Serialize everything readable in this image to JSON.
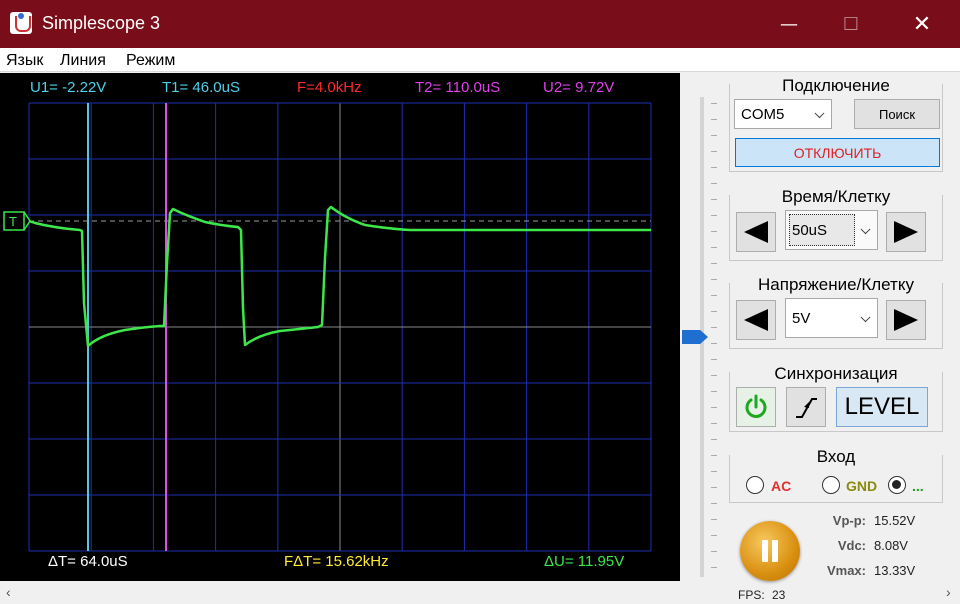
{
  "window": {
    "title": "Simplescope 3",
    "min_glyph": "—",
    "max_glyph": "☐",
    "close_glyph": "✕"
  },
  "menu": [
    "Язык",
    "Линия",
    "Режим"
  ],
  "scope": {
    "top_readouts": {
      "u1": "U1= -2.22V",
      "t1": "T1= 46.0uS",
      "f": "F=4.0kHz",
      "t2": "T2= 110.0uS",
      "u2": "U2= 9.72V"
    },
    "bottom_readouts": {
      "dt": "ΔT= 64.0uS",
      "fdt": "FΔT= 15.62kHz",
      "du": "ΔU= 11.95V"
    },
    "trigger_marker": "T",
    "colors": {
      "grid": "#1c2fb5",
      "trace": "#3de64a",
      "cursor1": "#56c8dc",
      "cursor2": "#e04fe8",
      "u1": "#4fd0e8",
      "t1": "#4fd0e8",
      "f": "#ff2a2a",
      "t2": "#e040e8",
      "u2": "#e040e8",
      "dt": "#ffffff",
      "fdt": "#ffea3a",
      "du": "#3de64a"
    }
  },
  "connection": {
    "title": "Подключение",
    "port": "COM5",
    "search_label": "Поиск",
    "disconnect_label": "ОТКЛЮЧИТЬ"
  },
  "time_div": {
    "title": "Время/Клетку",
    "value": "50uS"
  },
  "volt_div": {
    "title": "Напряжение/Клетку",
    "value": "5V"
  },
  "sync": {
    "title": "Синхронизация",
    "level_label": "LEVEL"
  },
  "input": {
    "title": "Вход",
    "options": [
      {
        "label": "AC",
        "color": "#e03030",
        "checked": false
      },
      {
        "label": "GND",
        "color": "#8a8a10",
        "checked": false
      },
      {
        "label": "...",
        "color": "#20a020",
        "checked": true
      }
    ]
  },
  "stats": {
    "vpp_label": "Vp-p:",
    "vpp": "15.52V",
    "vdc_label": "Vdc:",
    "vdc": "8.08V",
    "vmax_label": "Vmax:",
    "vmax": "13.33V",
    "fps_label": "FPS:",
    "fps": "23"
  }
}
